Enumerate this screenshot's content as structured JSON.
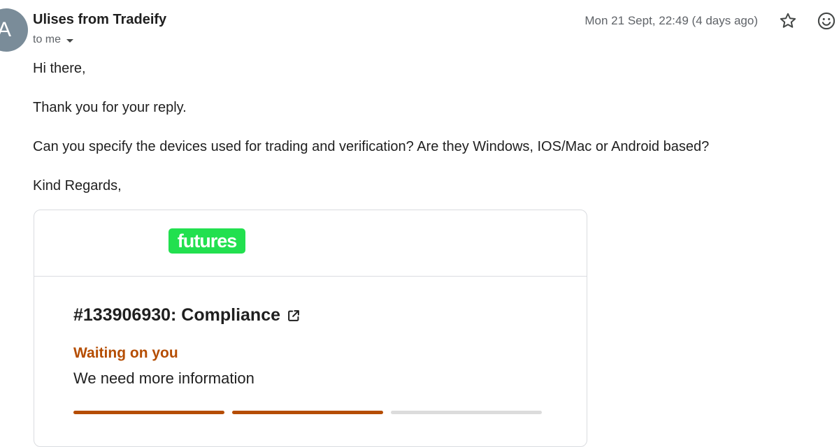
{
  "email": {
    "avatar_letter": "A",
    "sender": "Ulises from Tradeify",
    "recipient": "to me",
    "timestamp": "Mon 21 Sept, 22:49 (4 days ago)",
    "icons": {
      "star": "star-icon",
      "emoji": "emoji-icon",
      "recipient_toggle": "chevron-down-icon"
    }
  },
  "body": {
    "greeting": "Hi there,",
    "line1": "Thank you for your reply.",
    "line2": "Can you specify the devices used for trading and verification? Are they Windows, IOS/Mac or Android based?",
    "closing": "Kind Regards,"
  },
  "card": {
    "logo_text": "futures",
    "logo_color": "#22e04f",
    "ticket_title": "#133906930: Compliance",
    "ticket_link_icon": "external-link-icon",
    "status_label": "Waiting on you",
    "status_color": "#b54d02",
    "status_description": "We need more information",
    "progress": {
      "completed_steps": 2,
      "total_steps": 3
    }
  }
}
